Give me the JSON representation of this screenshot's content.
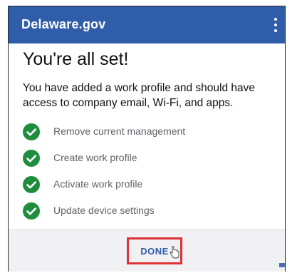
{
  "appbar": {
    "title": "Delaware.gov",
    "menu_icon": "more-vertical-icon"
  },
  "content": {
    "heading": "You're all set!",
    "description": "You have added a work profile and should have access to company email, Wi-Fi, and apps."
  },
  "steps": [
    {
      "label": "Remove current management",
      "icon": "check-circle-icon",
      "status": "complete"
    },
    {
      "label": "Create work profile",
      "icon": "check-circle-icon",
      "status": "complete"
    },
    {
      "label": "Activate work profile",
      "icon": "check-circle-icon",
      "status": "complete"
    },
    {
      "label": "Update device settings",
      "icon": "check-circle-icon",
      "status": "complete"
    }
  ],
  "footer": {
    "done_label": "DONE"
  },
  "colors": {
    "appbar": "#2f5da9",
    "check": "#1e8e3e",
    "highlight": "#e03137",
    "step_text": "#5f6368"
  }
}
